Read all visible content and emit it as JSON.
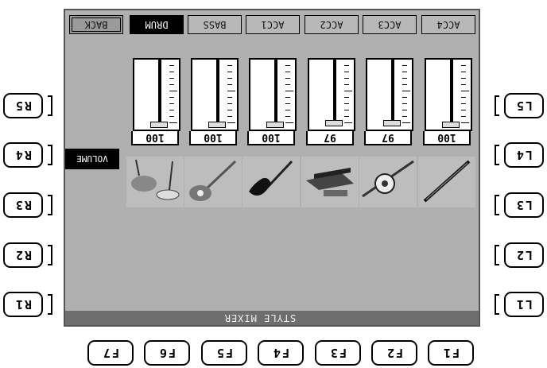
{
  "screen": {
    "title": "STYLE MIXER",
    "volume_label": "VOLUME"
  },
  "function_keys": [
    "F1",
    "F2",
    "F3",
    "F4",
    "F5",
    "F6",
    "F7"
  ],
  "left_keys": [
    "L1",
    "L2",
    "L3",
    "L4",
    "L5"
  ],
  "right_keys": [
    "R1",
    "R2",
    "R3",
    "R4",
    "R5"
  ],
  "tabs": [
    {
      "label": "BACK"
    },
    {
      "label": "DRUM"
    },
    {
      "label": "BASS"
    },
    {
      "label": "ACC1"
    },
    {
      "label": "ACC2"
    },
    {
      "label": "ACC3"
    },
    {
      "label": "ACC4"
    }
  ],
  "channels": [
    {
      "name": "drum",
      "value": "100",
      "level": 1.0,
      "icon": "drum-kit-icon"
    },
    {
      "name": "bass",
      "value": "100",
      "level": 1.0,
      "icon": "bass-guitar-icon"
    },
    {
      "name": "acc1",
      "value": "100",
      "level": 1.0,
      "icon": "electric-guitar-icon"
    },
    {
      "name": "acc2",
      "value": "97",
      "level": 0.97,
      "icon": "keyboard-icon"
    },
    {
      "name": "acc3",
      "value": "97",
      "level": 0.97,
      "icon": "banjo-icon"
    },
    {
      "name": "acc4",
      "value": "100",
      "level": 1.0,
      "icon": "clarinet-icon"
    }
  ],
  "colors": {
    "active_tab": "#000000",
    "screen_bg": "#b0b0b0",
    "title_bg": "#6e6e6e"
  }
}
